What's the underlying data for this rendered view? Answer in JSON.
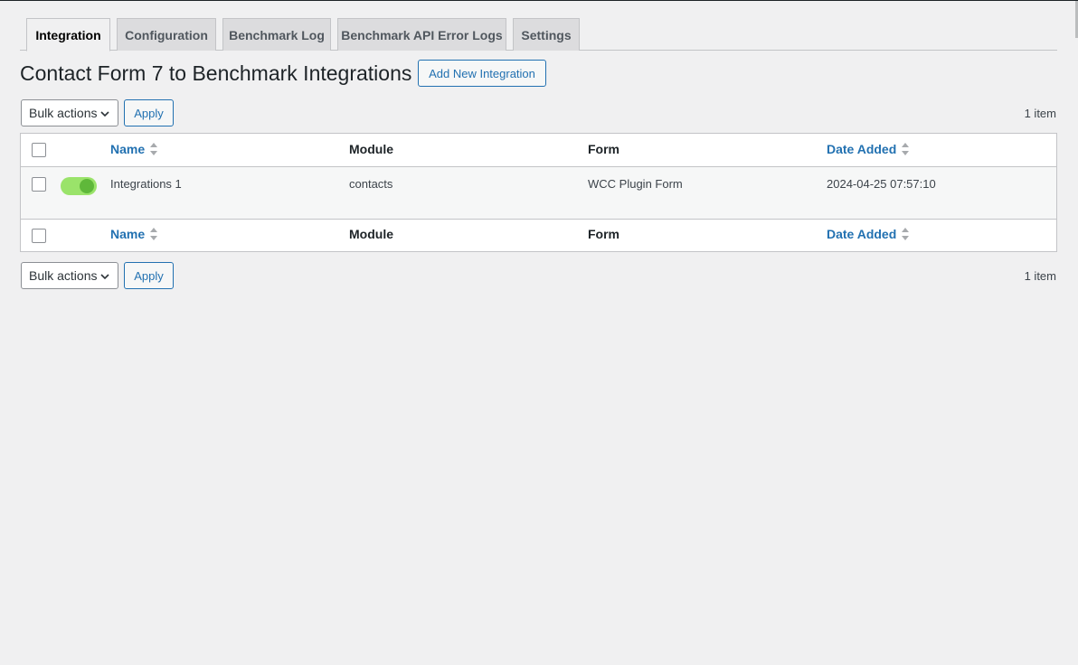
{
  "tabs": [
    {
      "label": "Integration",
      "active": true
    },
    {
      "label": "Configuration",
      "active": false
    },
    {
      "label": "Benchmark Log",
      "active": false
    },
    {
      "label": "Benchmark API Error Logs",
      "active": false
    },
    {
      "label": "Settings",
      "active": false
    }
  ],
  "page": {
    "title": "Contact Form 7 to Benchmark Integrations",
    "add_new_label": "Add New Integration"
  },
  "bulk": {
    "selected": "Bulk actions",
    "apply_label": "Apply",
    "item_count": "1 item"
  },
  "table": {
    "columns": {
      "name": "Name",
      "module": "Module",
      "form": "Form",
      "date_added": "Date Added"
    },
    "rows": [
      {
        "enabled": true,
        "name": "Integrations 1",
        "module": "contacts",
        "form": "WCC Plugin Form",
        "date_added": "2024-04-25 07:57:10"
      }
    ]
  },
  "colors": {
    "accent": "#2271b1",
    "toggle_on": "#9ae36a",
    "toggle_knob": "#5fb83a",
    "background": "#f0f0f1"
  }
}
